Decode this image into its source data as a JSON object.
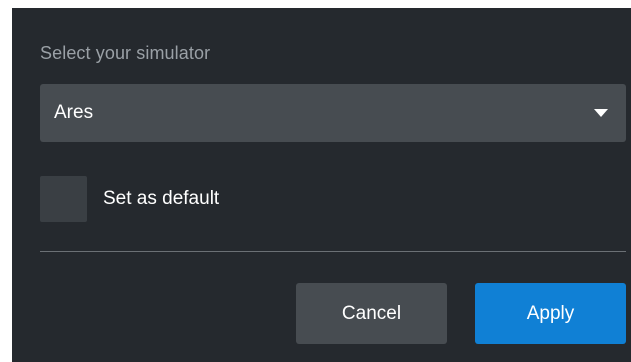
{
  "dialog": {
    "label": "Select your simulator",
    "select": {
      "value": "Ares"
    },
    "default_checkbox": {
      "label": "Set as default",
      "checked": false
    },
    "buttons": {
      "cancel": "Cancel",
      "apply": "Apply"
    }
  },
  "colors": {
    "dialog_background": "#25292e",
    "select_background": "#474c51",
    "checkbox_background": "#3a3f44",
    "apply_accent": "#1080d5",
    "label_text": "#9aa0a6"
  },
  "icons": {
    "dropdown": "caret-down-icon"
  }
}
